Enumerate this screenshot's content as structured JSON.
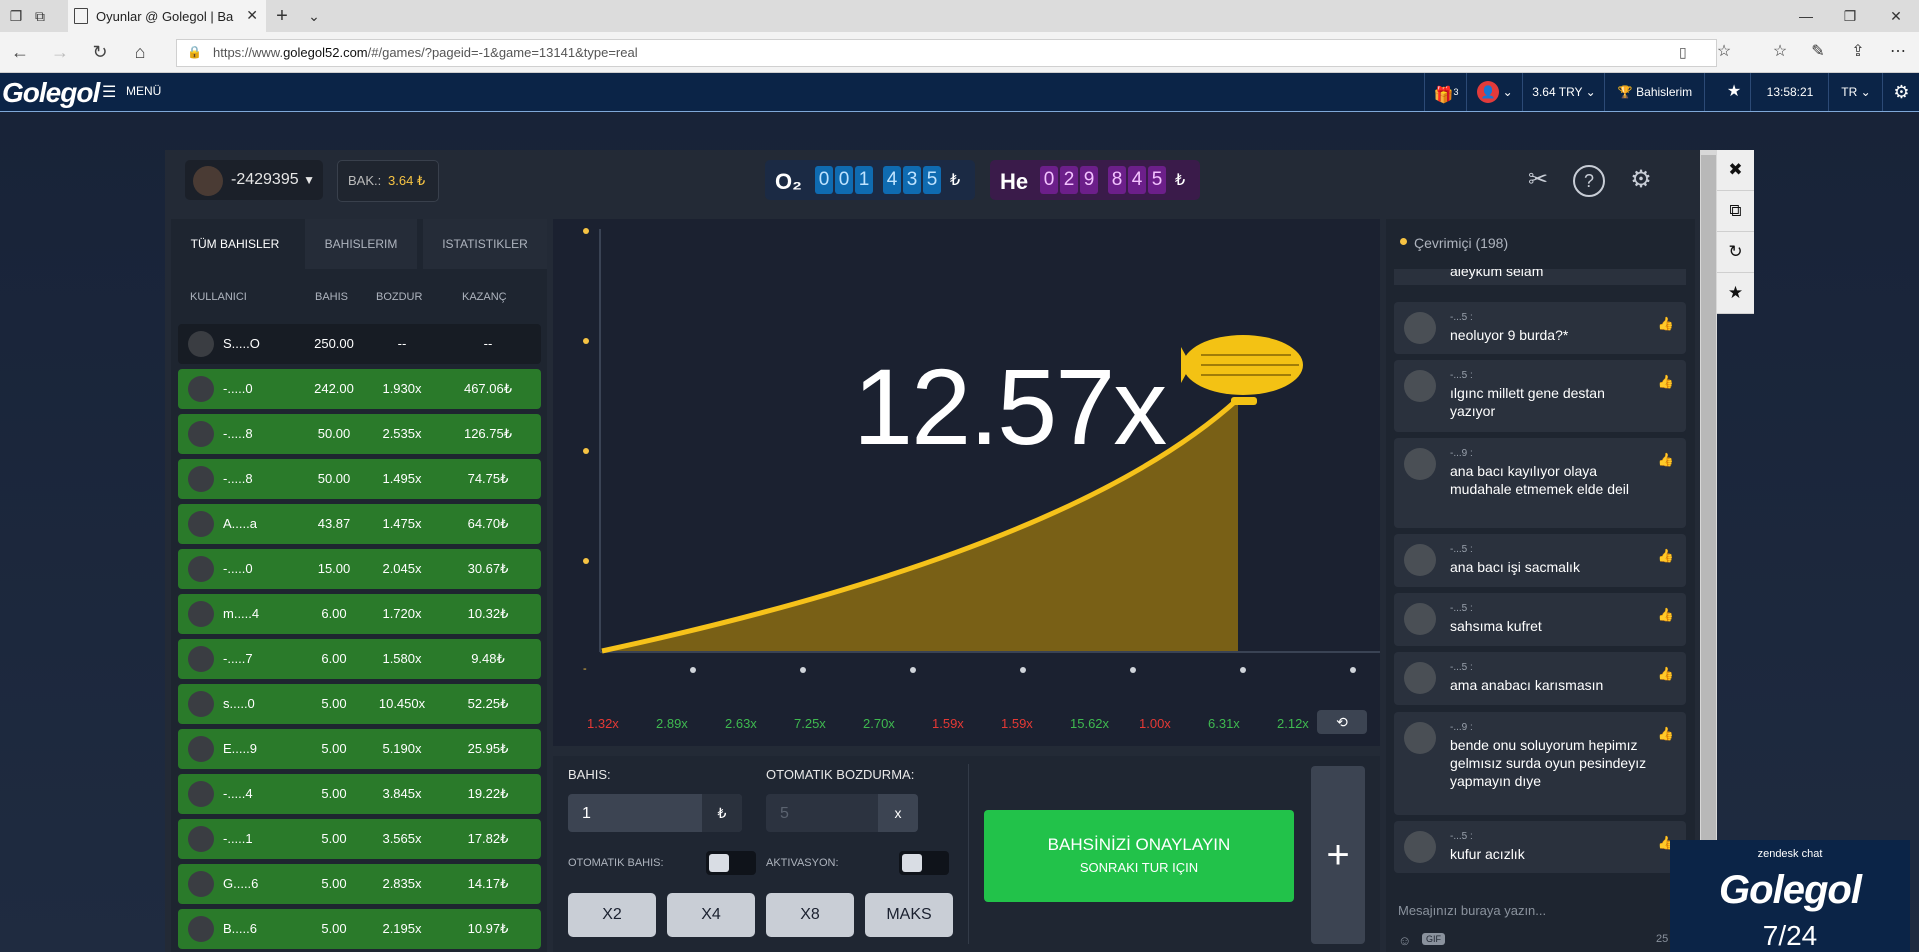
{
  "browser": {
    "tab_title": "Oyunlar @ Golegol | Ba",
    "url_prefix": "https://www.",
    "url_domain": "golegol52.com",
    "url_rest": "/#/games/?pageid=-1&game=13141&type=real"
  },
  "site_header": {
    "logo": "Golegol",
    "menu_label": "MENÜ",
    "gift_count": "3",
    "balance": "3.64 TRY",
    "my_bets": "Bahislerim",
    "clock": "13:58:21",
    "language": "TR"
  },
  "game_top": {
    "username": "-2429395",
    "balance_label": "BAK.:",
    "balance_value": "3.64 ₺",
    "o2_symbol": "O₂",
    "o2_digits": [
      "0",
      "0",
      "1",
      "4",
      "3",
      "5"
    ],
    "he_symbol": "He",
    "he_digits": [
      "0",
      "2",
      "9",
      "8",
      "4",
      "5"
    ],
    "currency": "₺"
  },
  "bets": {
    "tabs": [
      "TÜM BAHISLER",
      "BAHISLERIM",
      "ISTATISTIKLER"
    ],
    "columns": [
      "KULLANICI",
      "BAHIS",
      "BOZDUR",
      "KAZANÇ"
    ],
    "rows": [
      {
        "user": "S.....O",
        "bet": "250.00",
        "cashout": "--",
        "win": "--",
        "state": "dark"
      },
      {
        "user": "-.....0",
        "bet": "242.00",
        "cashout": "1.930x",
        "win": "467.06₺",
        "state": "green"
      },
      {
        "user": "-.....8",
        "bet": "50.00",
        "cashout": "2.535x",
        "win": "126.75₺",
        "state": "green"
      },
      {
        "user": "-.....8",
        "bet": "50.00",
        "cashout": "1.495x",
        "win": "74.75₺",
        "state": "green"
      },
      {
        "user": "A.....a",
        "bet": "43.87",
        "cashout": "1.475x",
        "win": "64.70₺",
        "state": "green"
      },
      {
        "user": "-.....0",
        "bet": "15.00",
        "cashout": "2.045x",
        "win": "30.67₺",
        "state": "green"
      },
      {
        "user": "m.....4",
        "bet": "6.00",
        "cashout": "1.720x",
        "win": "10.32₺",
        "state": "green"
      },
      {
        "user": "-.....7",
        "bet": "6.00",
        "cashout": "1.580x",
        "win": "9.48₺",
        "state": "green"
      },
      {
        "user": "s.....0",
        "bet": "5.00",
        "cashout": "10.450x",
        "win": "52.25₺",
        "state": "green"
      },
      {
        "user": "E.....9",
        "bet": "5.00",
        "cashout": "5.190x",
        "win": "25.95₺",
        "state": "green"
      },
      {
        "user": "-.....4",
        "bet": "5.00",
        "cashout": "3.845x",
        "win": "19.22₺",
        "state": "green"
      },
      {
        "user": "-.....1",
        "bet": "5.00",
        "cashout": "3.565x",
        "win": "17.82₺",
        "state": "green"
      },
      {
        "user": "G.....6",
        "bet": "5.00",
        "cashout": "2.835x",
        "win": "14.17₺",
        "state": "green"
      },
      {
        "user": "B.....6",
        "bet": "5.00",
        "cashout": "2.195x",
        "win": "10.97₺",
        "state": "green"
      }
    ]
  },
  "game": {
    "multiplier": "12.57x",
    "history": [
      {
        "v": "1.32x",
        "c": "#e53935"
      },
      {
        "v": "2.89x",
        "c": "#3fb950"
      },
      {
        "v": "2.63x",
        "c": "#3fb950"
      },
      {
        "v": "7.25x",
        "c": "#3fb950"
      },
      {
        "v": "2.70x",
        "c": "#3fb950"
      },
      {
        "v": "1.59x",
        "c": "#e53935"
      },
      {
        "v": "1.59x",
        "c": "#e53935"
      },
      {
        "v": "15.62x",
        "c": "#3fb950"
      },
      {
        "v": "1.00x",
        "c": "#e53935"
      },
      {
        "v": "6.31x",
        "c": "#3fb950"
      },
      {
        "v": "2.12x",
        "c": "#3fb950"
      }
    ]
  },
  "controls": {
    "bet_label": "BAHIS:",
    "bet_value": "1",
    "bet_suffix": "₺",
    "auto_cashout_label": "OTOMATIK BOZDURMA:",
    "auto_cashout_placeholder": "5",
    "auto_cashout_suffix": "x",
    "auto_bet_label": "OTOMATIK BAHIS:",
    "activation_label": "AKTIVASYON:",
    "quick": [
      "X2",
      "X4",
      "X8",
      "MAKS"
    ],
    "confirm_line1": "BAHSİNİZİ ONAYLAYIN",
    "confirm_line2": "SONRAKI TUR IÇIN",
    "plus": "+"
  },
  "chat": {
    "online_label": "Çevrimiçi (198)",
    "partial_top": "aleykum selam",
    "messages": [
      {
        "name": "-...5 :",
        "text": "neoluyor 9 burda?*"
      },
      {
        "name": "-...5 :",
        "text": "ılgınc millett gene destan yazıyor"
      },
      {
        "name": "-...9 :",
        "text": "ana bacı kayılıyor olaya mudahale etmemek elde deil"
      },
      {
        "name": "-...5 :",
        "text": "ana bacı işi sacmalık"
      },
      {
        "name": "-...5 :",
        "text": "sahsıma kufret"
      },
      {
        "name": "-...5 :",
        "text": "ama anabacı karısmasın"
      },
      {
        "name": "-...9 :",
        "text": "bende onu soluyorum hepimız gelmısız surda oyun pesindeyız yapmayın dıye"
      },
      {
        "name": "-...5 :",
        "text": "kufur acızlık"
      }
    ],
    "input_placeholder": "Mesajınızı buraya yazın...",
    "gif_label": "GIF",
    "char_count": "25"
  },
  "zendesk": {
    "title": "zendesk chat",
    "logo": "Golegol",
    "hours": "7/24"
  }
}
